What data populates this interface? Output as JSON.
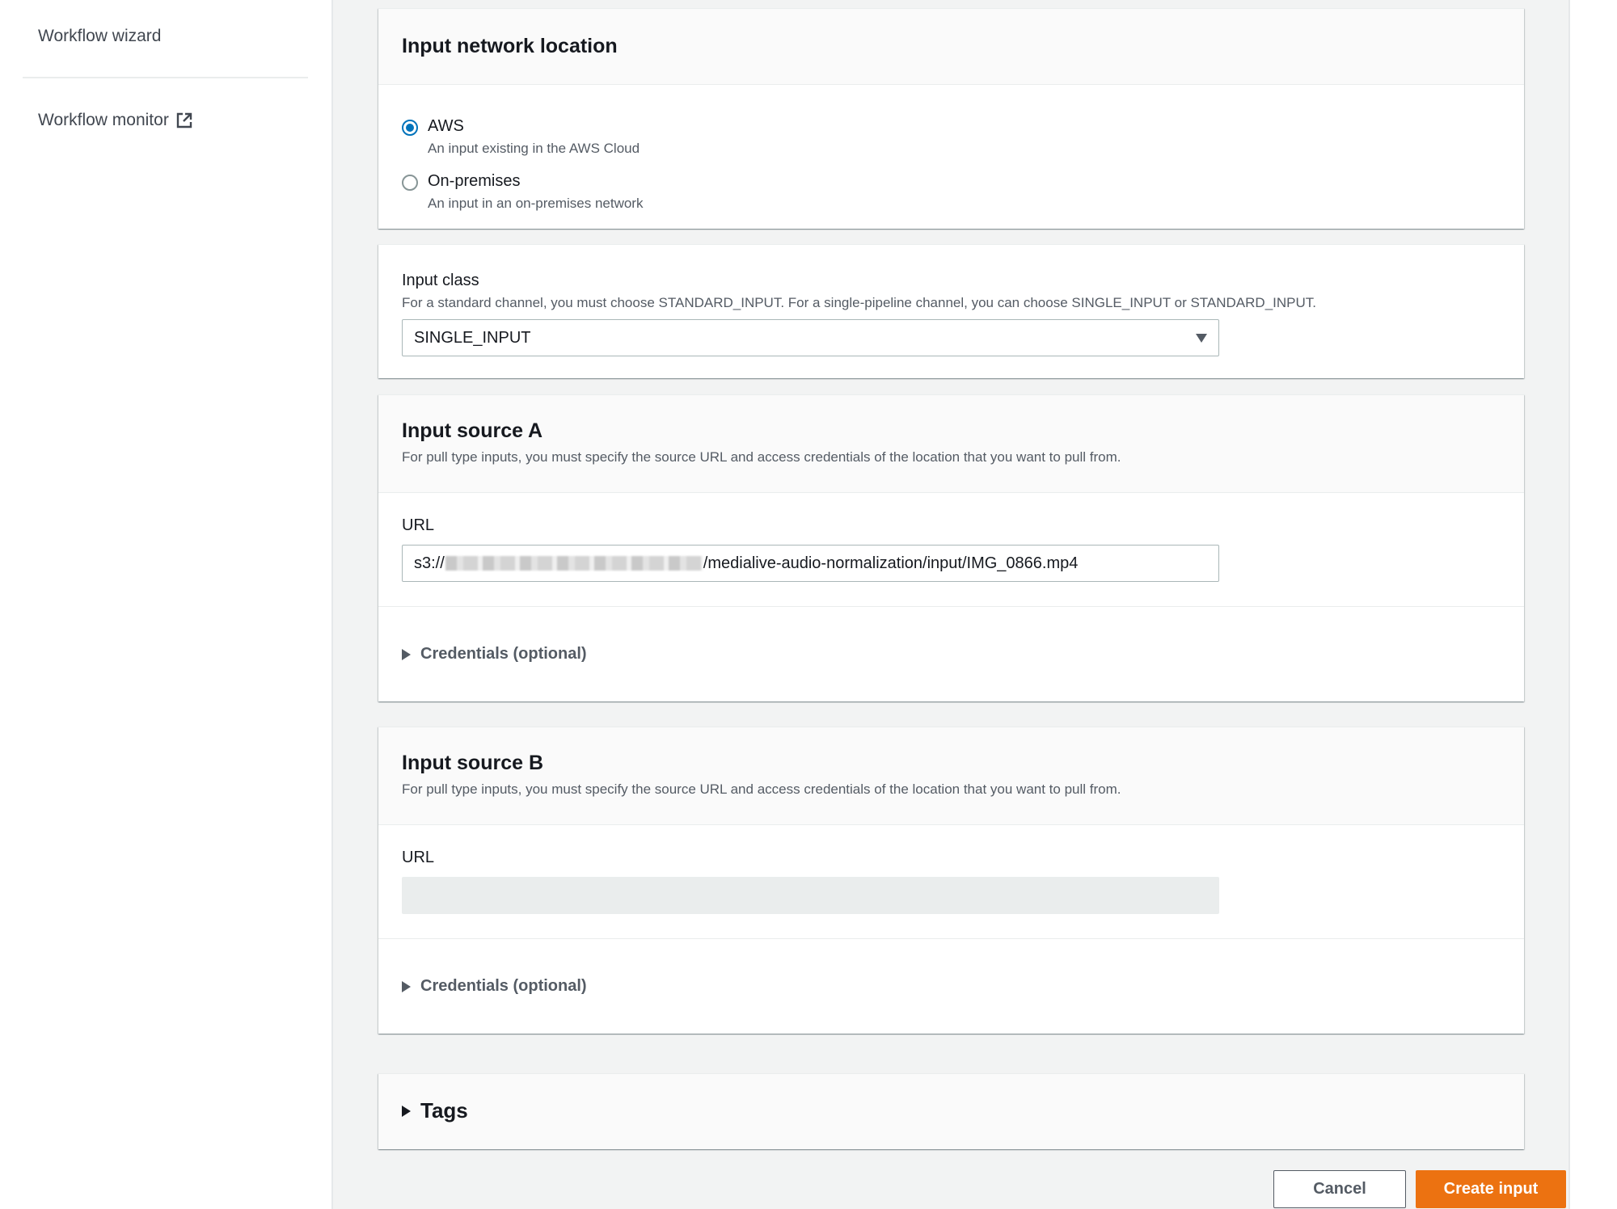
{
  "sidebar": {
    "items": [
      {
        "label": "Workflow wizard"
      },
      {
        "label": "Workflow monitor",
        "icon": "external-link-icon"
      }
    ]
  },
  "network_location": {
    "title": "Input network location",
    "options": [
      {
        "label": "AWS",
        "description": "An input existing in the AWS Cloud",
        "selected": true
      },
      {
        "label": "On-premises",
        "description": "An input in an on-premises network",
        "selected": false
      }
    ]
  },
  "input_class": {
    "label": "Input class",
    "description": "For a standard channel, you must choose STANDARD_INPUT. For a single-pipeline channel, you can choose SINGLE_INPUT or STANDARD_INPUT.",
    "selected": "SINGLE_INPUT"
  },
  "source_a": {
    "title": "Input source A",
    "description": "For pull type inputs, you must specify the source URL and access credentials of the location that you want to pull from.",
    "url_label": "URL",
    "url_prefix": "s3://",
    "url_suffix": "/medialive-audio-normalization/input/IMG_0866.mp4",
    "credentials_label": "Credentials (optional)"
  },
  "source_b": {
    "title": "Input source B",
    "description": "For pull type inputs, you must specify the source URL and access credentials of the location that you want to pull from.",
    "url_label": "URL",
    "url_value": "",
    "credentials_label": "Credentials (optional)"
  },
  "tags": {
    "label": "Tags"
  },
  "actions": {
    "cancel": "Cancel",
    "create": "Create input"
  },
  "colors": {
    "primary": "#ec7211",
    "radio_selected": "#0073bb"
  }
}
